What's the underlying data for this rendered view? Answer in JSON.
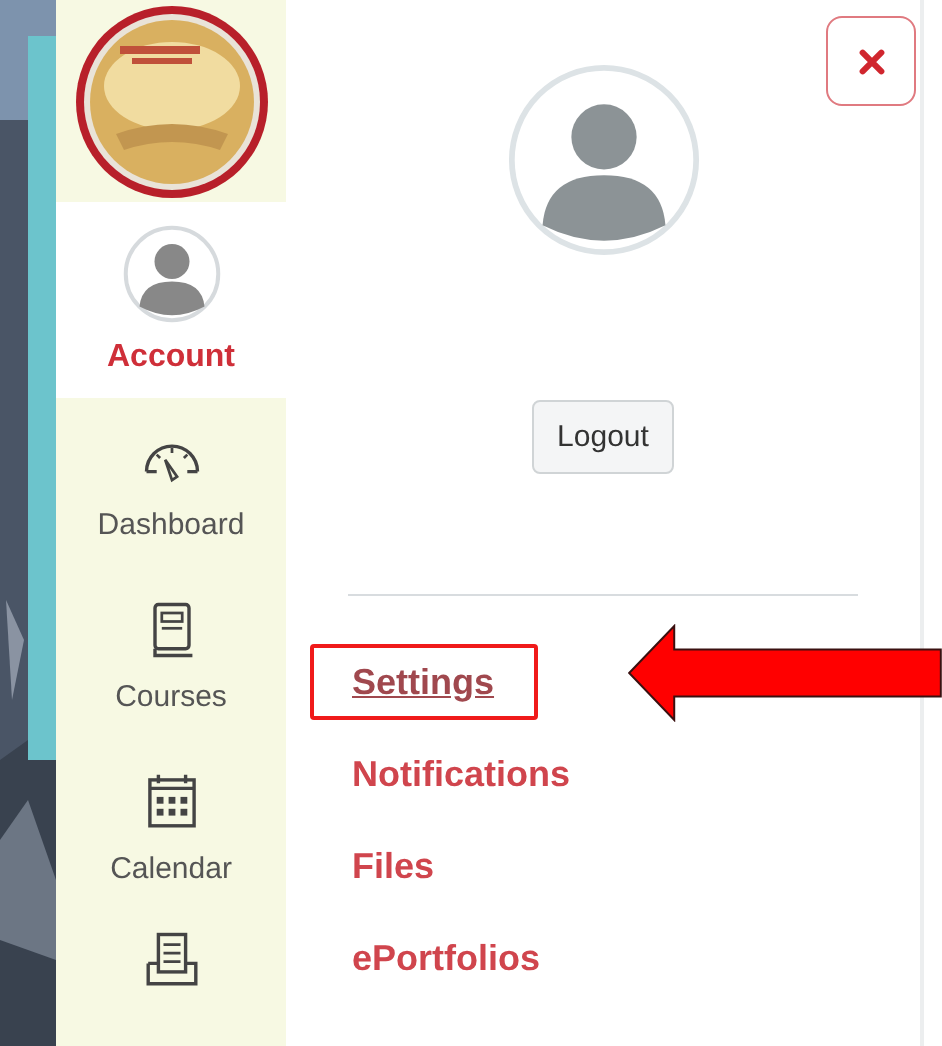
{
  "sidebar": {
    "items": [
      {
        "kind": "account",
        "label": "Account",
        "selected": true
      },
      {
        "kind": "dashboard",
        "label": "Dashboard",
        "selected": false
      },
      {
        "kind": "courses",
        "label": "Courses",
        "selected": false
      },
      {
        "kind": "calendar",
        "label": "Calendar",
        "selected": false
      },
      {
        "kind": "inbox",
        "selected": false
      }
    ]
  },
  "account_panel": {
    "logout_button": "Logout",
    "links": [
      {
        "label": "Settings",
        "selected": true
      },
      {
        "label": "Notifications",
        "selected": false
      },
      {
        "label": "Files",
        "selected": false
      },
      {
        "label": "ePortfolios",
        "selected": false
      }
    ]
  }
}
